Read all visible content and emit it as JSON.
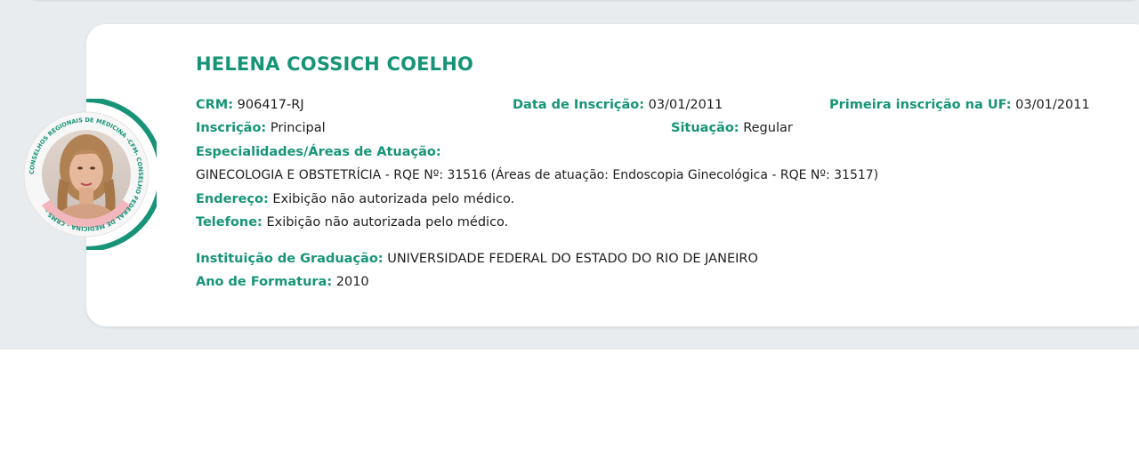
{
  "doctor": {
    "name": "HELENA COSSICH COELHO",
    "photo_ring_text": "CONSELHOS REGIONAIS DE MEDICINA -CFM- CONSELHO FEDERAL DE MEDICINA - CRMS -"
  },
  "fields": {
    "crm": {
      "label": "CRM:",
      "value": "906417-RJ"
    },
    "data_inscricao": {
      "label": "Data de Inscrição:",
      "value": "03/01/2011"
    },
    "primeira_inscricao": {
      "label": "Primeira inscrição na UF:",
      "value": "03/01/2011"
    },
    "inscricao": {
      "label": "Inscrição:",
      "value": "Principal"
    },
    "situacao": {
      "label": "Situação:",
      "value": "Regular"
    },
    "especialidades": {
      "label": "Especialidades/Áreas de Atuação:",
      "value": "GINECOLOGIA E OBSTETRÍCIA - RQE Nº: 31516 (Áreas de atuação: Endoscopia Ginecológica - RQE Nº: 31517)"
    },
    "endereco": {
      "label": "Endereço:",
      "value": "Exibição não autorizada pelo médico."
    },
    "telefone": {
      "label": "Telefone:",
      "value": "Exibição não autorizada pelo médico."
    },
    "instituicao": {
      "label": "Instituição de Graduação:",
      "value": "UNIVERSIDADE FEDERAL DO ESTADO DO RIO DE JANEIRO"
    },
    "ano_formatura": {
      "label": "Ano de Formatura:",
      "value": "2010"
    }
  },
  "colors": {
    "accent": "#179478",
    "page_background": "#e8ecef",
    "card_background": "#ffffff"
  }
}
